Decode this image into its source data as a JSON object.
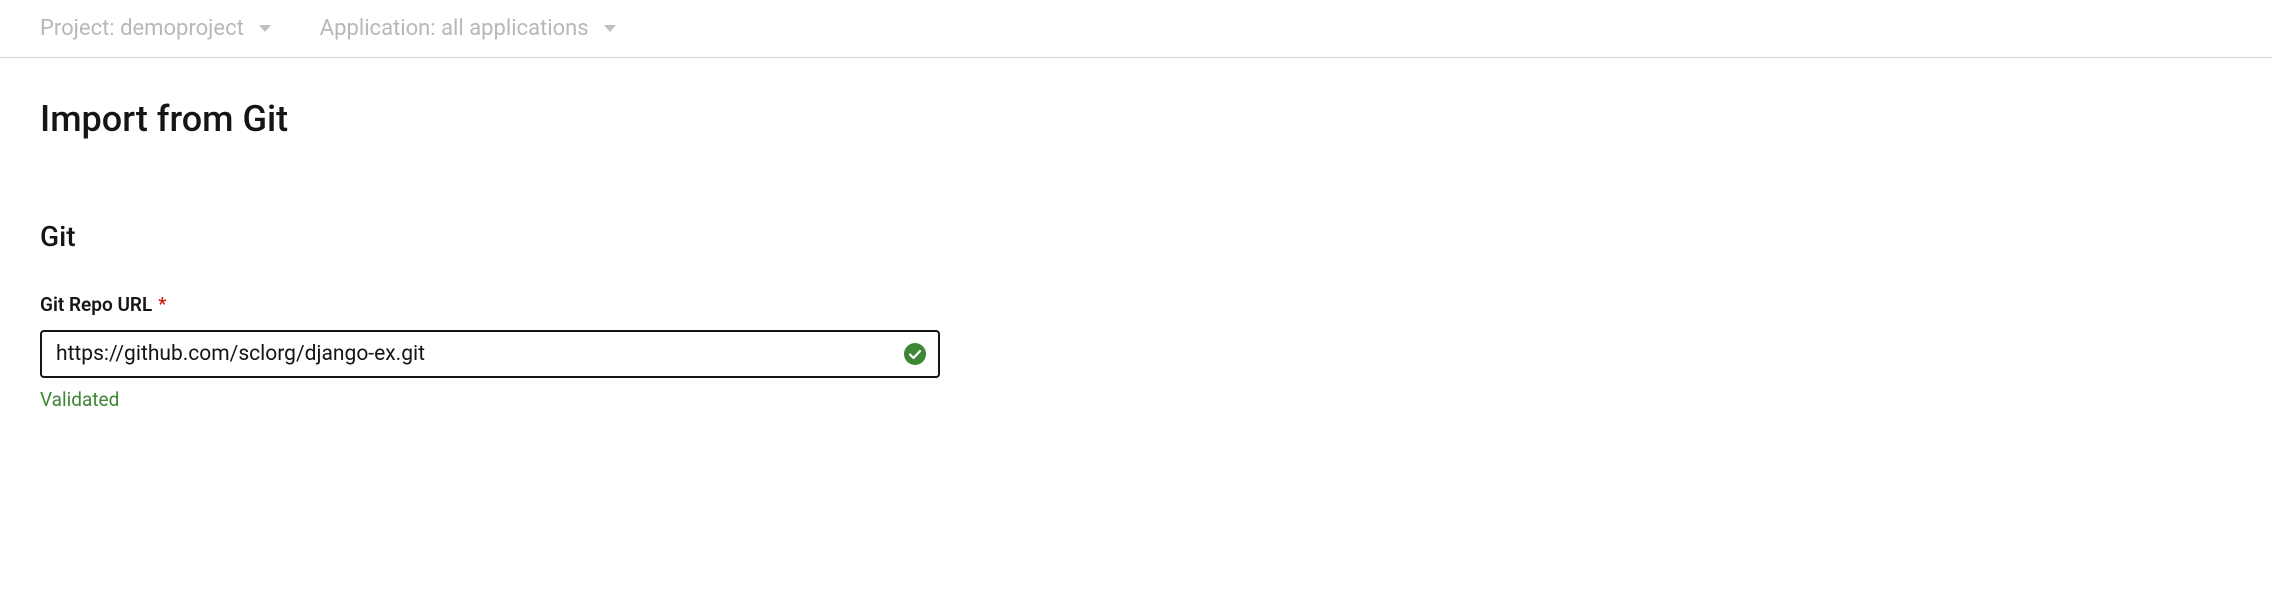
{
  "topbar": {
    "project_dropdown": {
      "label": "Project: demoproject"
    },
    "application_dropdown": {
      "label": "Application: all applications"
    }
  },
  "page": {
    "title": "Import from Git"
  },
  "git_section": {
    "heading": "Git",
    "repo_url": {
      "label": "Git Repo URL",
      "required_mark": "*",
      "value": "https://github.com/sclorg/django-ex.git",
      "validation_status": "Validated"
    }
  }
}
